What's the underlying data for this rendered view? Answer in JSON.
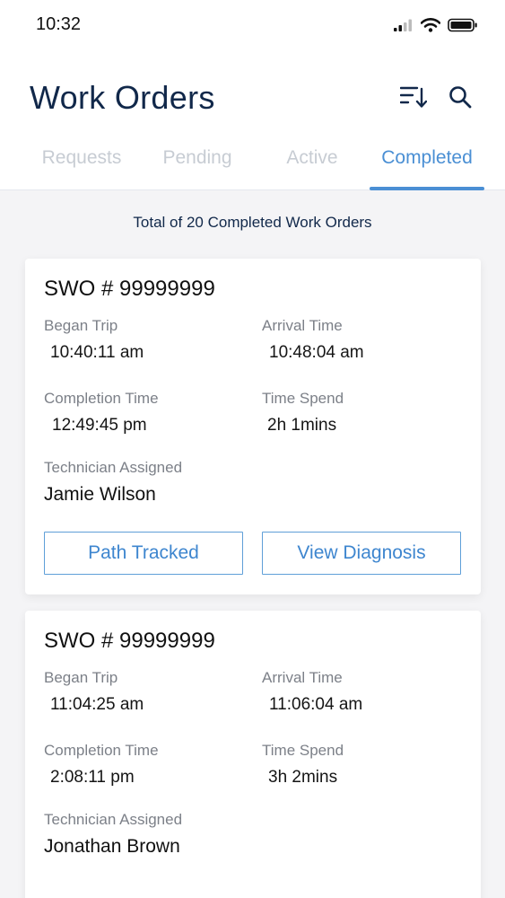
{
  "status_bar": {
    "time": "10:32"
  },
  "header": {
    "title": "Work Orders"
  },
  "tabs": [
    {
      "label": "Requests",
      "active": false
    },
    {
      "label": "Pending",
      "active": false
    },
    {
      "label": "Active",
      "active": false
    },
    {
      "label": "Completed",
      "active": true
    }
  ],
  "summary": "Total of 20 Completed Work Orders",
  "cards": [
    {
      "swo": "SWO # 99999999",
      "began_trip_label": "Began Trip",
      "began_trip": "10:40:11 am",
      "arrival_label": "Arrival Time",
      "arrival": "10:48:04 am",
      "completion_label": "Completion Time",
      "completion": "12:49:45 pm",
      "spend_label": "Time Spend",
      "spend": "2h 1mins",
      "tech_label": "Technician Assigned",
      "tech": "Jamie Wilson",
      "path_button": "Path Tracked",
      "diagnosis_button": "View Diagnosis"
    },
    {
      "swo": "SWO # 99999999",
      "began_trip_label": "Began Trip",
      "began_trip": "11:04:25 am",
      "arrival_label": "Arrival Time",
      "arrival": "11:06:04 am",
      "completion_label": "Completion Time",
      "completion": "2:08:11 pm",
      "spend_label": "Time Spend",
      "spend": "3h 2mins",
      "tech_label": "Technician Assigned",
      "tech": "Jonathan Brown"
    }
  ],
  "colors": {
    "accent": "#4a8fd4",
    "title": "#11284a",
    "inactive_tab": "#c7ccd3"
  },
  "icons": [
    "signal-icon",
    "wifi-icon",
    "battery-icon",
    "sort-icon",
    "search-icon"
  ]
}
